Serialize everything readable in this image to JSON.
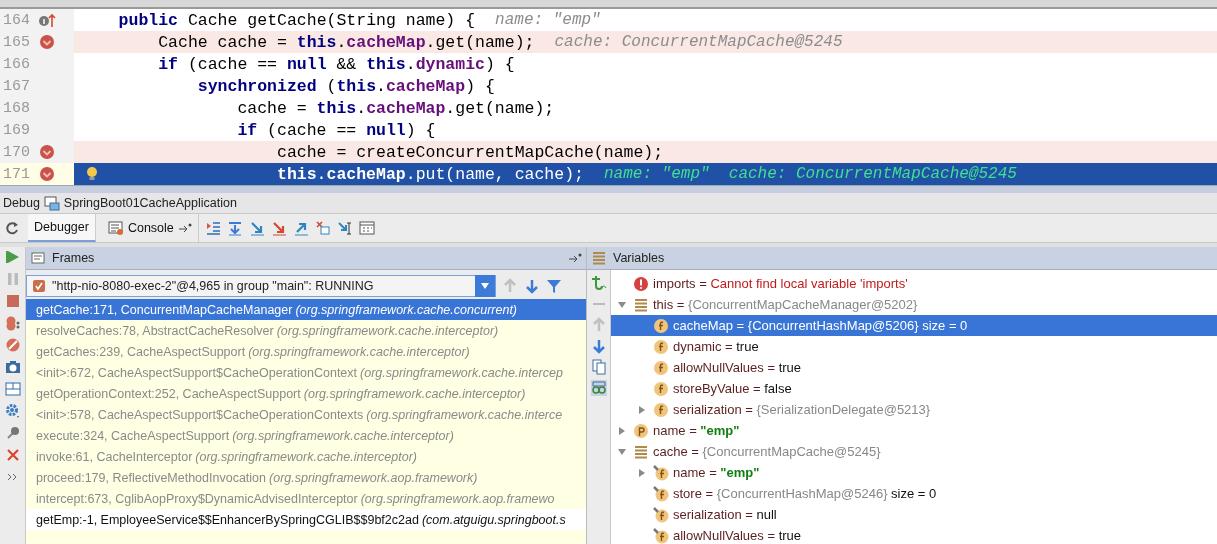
{
  "editor": {
    "lines": [
      {
        "number": "164",
        "implements_marker": true,
        "breakpoint": false,
        "current": false,
        "tokens": [
          {
            "kind": "kw",
            "text": "    public"
          },
          {
            "kind": "plain",
            "text": " Cache getCache(String name) {"
          }
        ],
        "hint": "name: \"emp\""
      },
      {
        "number": "165",
        "breakpoint": true,
        "current": false,
        "tokens": [
          {
            "kind": "plain",
            "text": "        Cache cache = "
          },
          {
            "kind": "kw",
            "text": "this"
          },
          {
            "kind": "plain",
            "text": "."
          },
          {
            "kind": "field",
            "text": "cacheMap"
          },
          {
            "kind": "plain",
            "text": ".get(name);"
          }
        ],
        "hint": "cache: ConcurrentMapCache@5245"
      },
      {
        "number": "166",
        "breakpoint": false,
        "current": false,
        "tokens": [
          {
            "kind": "kw",
            "text": "        if"
          },
          {
            "kind": "plain",
            "text": " (cache == "
          },
          {
            "kind": "kw",
            "text": "null"
          },
          {
            "kind": "plain",
            "text": " && "
          },
          {
            "kind": "kw",
            "text": "this"
          },
          {
            "kind": "plain",
            "text": "."
          },
          {
            "kind": "field",
            "text": "dynamic"
          },
          {
            "kind": "plain",
            "text": ") {"
          }
        ]
      },
      {
        "number": "167",
        "breakpoint": false,
        "current": false,
        "tokens": [
          {
            "kind": "kw",
            "text": "            synchronized"
          },
          {
            "kind": "plain",
            "text": " ("
          },
          {
            "kind": "kw",
            "text": "this"
          },
          {
            "kind": "plain",
            "text": "."
          },
          {
            "kind": "field",
            "text": "cacheMap"
          },
          {
            "kind": "plain",
            "text": ") {"
          }
        ]
      },
      {
        "number": "168",
        "breakpoint": false,
        "current": false,
        "tokens": [
          {
            "kind": "plain",
            "text": "                cache = "
          },
          {
            "kind": "kw",
            "text": "this"
          },
          {
            "kind": "plain",
            "text": "."
          },
          {
            "kind": "field",
            "text": "cacheMap"
          },
          {
            "kind": "plain",
            "text": ".get(name);"
          }
        ]
      },
      {
        "number": "169",
        "breakpoint": false,
        "current": false,
        "tokens": [
          {
            "kind": "kw",
            "text": "                if"
          },
          {
            "kind": "plain",
            "text": " (cache == "
          },
          {
            "kind": "kw",
            "text": "null"
          },
          {
            "kind": "plain",
            "text": ") {"
          }
        ]
      },
      {
        "number": "170",
        "breakpoint": true,
        "current": false,
        "tokens": [
          {
            "kind": "plain",
            "text": "                    cache = createConcurrentMapCache(name);"
          }
        ]
      },
      {
        "number": "171",
        "breakpoint": true,
        "current": true,
        "bulb": true,
        "tokens": [
          {
            "kind": "kw",
            "text": "                    this"
          },
          {
            "kind": "plain",
            "text": "."
          },
          {
            "kind": "field",
            "text": "cacheMap"
          },
          {
            "kind": "plain",
            "text": ".put(name, cache);"
          }
        ],
        "hint": "name: \"emp\"  cache: ConcurrentMapCache@5245"
      }
    ]
  },
  "debug_bar": {
    "label": "Debug",
    "config": "SpringBoot01CacheApplication"
  },
  "tabs": [
    {
      "label": "Debugger",
      "selected": true
    },
    {
      "label": "Console",
      "selected": false
    }
  ],
  "frames": {
    "title": "Frames",
    "thread": "\"http-nio-8080-exec-2\"@4,965 in group \"main\": RUNNING",
    "items": [
      {
        "method": "getCache:171, ConcurrentMapCacheManager",
        "package": "(org.springframework.cache.concurrent)",
        "kind": "library",
        "selected": true
      },
      {
        "method": "resolveCaches:78, AbstractCacheResolver",
        "package": "(org.springframework.cache.interceptor)",
        "kind": "library",
        "selected": false
      },
      {
        "method": "getCaches:239, CacheAspectSupport",
        "package": "(org.springframework.cache.interceptor)",
        "kind": "library",
        "selected": false
      },
      {
        "method": "<init>:672, CacheAspectSupport$CacheOperationContext",
        "package": "(org.springframework.cache.intercep",
        "kind": "library",
        "selected": false
      },
      {
        "method": "getOperationContext:252, CacheAspectSupport",
        "package": "(org.springframework.cache.interceptor)",
        "kind": "library",
        "selected": false
      },
      {
        "method": "<init>:578, CacheAspectSupport$CacheOperationContexts",
        "package": "(org.springframework.cache.interce",
        "kind": "library",
        "selected": false
      },
      {
        "method": "execute:324, CacheAspectSupport",
        "package": "(org.springframework.cache.interceptor)",
        "kind": "library",
        "selected": false
      },
      {
        "method": "invoke:61, CacheInterceptor",
        "package": "(org.springframework.cache.interceptor)",
        "kind": "library",
        "selected": false
      },
      {
        "method": "proceed:179, ReflectiveMethodInvocation",
        "package": "(org.springframework.aop.framework)",
        "kind": "library",
        "selected": false
      },
      {
        "method": "intercept:673, CglibAopProxy$DynamicAdvisedInterceptor",
        "package": "(org.springframework.aop.framewo",
        "kind": "library",
        "selected": false
      },
      {
        "method": "getEmp:-1, EmployeeService$$EnhancerBySpringCGLIB$$9bf2c2ad",
        "package": "(com.atguigu.springboot.s",
        "kind": "user",
        "selected": false
      }
    ]
  },
  "variables": {
    "title": "Variables",
    "items": [
      {
        "kind": "error",
        "label": "imports =",
        "value": {
          "kind": "error",
          "text": "Cannot find local variable 'imports'"
        },
        "selected": false
      },
      {
        "kind": "object",
        "label": "this =",
        "value": {
          "kind": "ref",
          "text": "{ConcurrentMapCacheManager@5202}"
        },
        "expanded": true,
        "selected": false,
        "children": [
          {
            "kind": "field",
            "label": "cacheMap =",
            "value": {
              "kind": "ref",
              "text": "{ConcurrentHashMap@5206}"
            },
            "extra": "size = 0",
            "selected": true
          },
          {
            "kind": "field",
            "label": "dynamic =",
            "value": {
              "kind": "literal",
              "text": "true"
            },
            "selected": false
          },
          {
            "kind": "field",
            "label": "allowNullValues =",
            "value": {
              "kind": "literal",
              "text": "true"
            },
            "selected": false
          },
          {
            "kind": "field",
            "label": "storeByValue =",
            "value": {
              "kind": "literal",
              "text": "false"
            },
            "selected": false
          },
          {
            "kind": "field",
            "label": "serialization =",
            "value": {
              "kind": "ref",
              "text": "{SerializationDelegate@5213}"
            },
            "expanded": false,
            "selected": false
          }
        ]
      },
      {
        "kind": "param",
        "label": "name =",
        "value": {
          "kind": "string",
          "text": "\"emp\""
        },
        "expanded": false,
        "selected": false
      },
      {
        "kind": "object",
        "label": "cache =",
        "value": {
          "kind": "ref",
          "text": "{ConcurrentMapCache@5245}"
        },
        "expanded": true,
        "selected": false,
        "children": [
          {
            "kind": "final_field",
            "label": "name =",
            "value": {
              "kind": "string",
              "text": "\"emp\""
            },
            "expanded": false,
            "selected": false
          },
          {
            "kind": "final_field",
            "label": "store =",
            "value": {
              "kind": "ref",
              "text": "{ConcurrentHashMap@5246}"
            },
            "extra": "size = 0",
            "selected": false
          },
          {
            "kind": "final_field",
            "label": "serialization =",
            "value": {
              "kind": "literal",
              "text": "null"
            },
            "selected": false
          },
          {
            "kind": "final_field",
            "label": "allowNullValues =",
            "value": {
              "kind": "literal",
              "text": "true"
            },
            "selected": false
          }
        ]
      }
    ]
  }
}
